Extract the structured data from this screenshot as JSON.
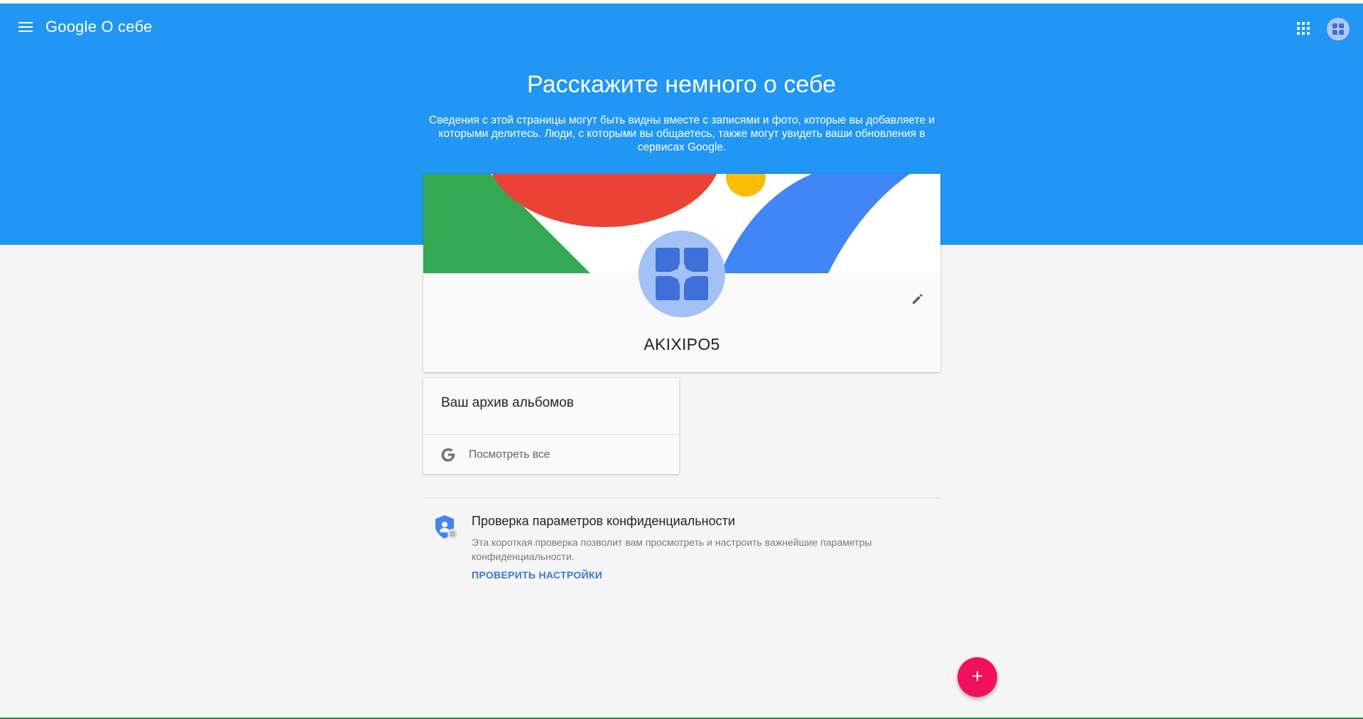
{
  "appbar": {
    "brand_google": "Google",
    "brand_product": "О себе"
  },
  "icons": {
    "menu": "menu-icon",
    "apps": "apps-grid-icon",
    "account": "account-avatar-icon",
    "edit": "pencil-icon",
    "google": "google-g-icon",
    "privacy": "shield-person-icon",
    "add": "plus-icon"
  },
  "hero": {
    "title": "Расскажите немного о себе",
    "subtitle": "Сведения с этой страницы могут быть видны вместе с записями и фото, которые вы добавляете и которыми делитесь. Люди, с которыми вы общаетесь, также могут увидеть ваши обновления в сервисах Google."
  },
  "profile": {
    "name": "AKIXIPO5"
  },
  "albums": {
    "title": "Ваш архив альбомов",
    "link_label": "Посмотреть все"
  },
  "privacy": {
    "title": "Проверка параметров конфиденциальности",
    "description": "Эта короткая проверка позволит вам просмотреть и настроить важнейшие параметры конфиденциальности.",
    "action_label": "ПРОВЕРИТЬ НАСТРОЙКИ"
  },
  "fab": {
    "glyph": "+"
  },
  "colors": {
    "hero_blue": "#2196f3",
    "fab_pink": "#f0105d",
    "link_blue": "#3c78d8",
    "banner_green": "#34a853",
    "banner_red": "#ea4335",
    "banner_yellow": "#fbbc05",
    "banner_blue": "#4285f4"
  }
}
